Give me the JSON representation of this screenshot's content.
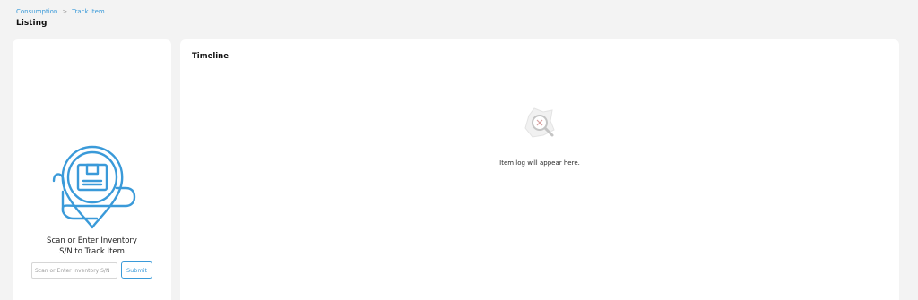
{
  "breadcrumb": {
    "items": [
      "Consumption",
      "Track Item"
    ],
    "separator": ">"
  },
  "page": {
    "title": "Listing"
  },
  "scan_panel": {
    "prompt_line1": "Scan or Enter Inventory",
    "prompt_line2": "S/N to Track Item",
    "input_placeholder": "Scan or Enter Inventory S/N",
    "input_value": "",
    "submit_label": "Submit",
    "icon": "location-pin-box-icon"
  },
  "timeline": {
    "title": "Timeline",
    "empty_message": "Item log will appear here.",
    "empty_icon": "search-no-results-icon"
  },
  "colors": {
    "accent": "#3a9ad9",
    "background": "#f3f3f3",
    "card": "#ffffff"
  }
}
